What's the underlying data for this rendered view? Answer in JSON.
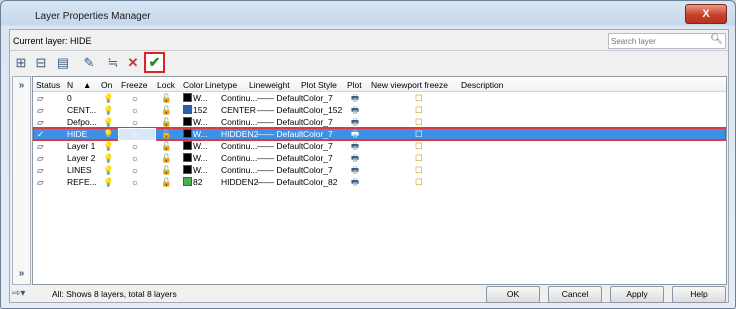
{
  "window": {
    "title": "Layer Properties Manager",
    "close_label": "X"
  },
  "current_layer": {
    "label": "Current layer: HIDE"
  },
  "search": {
    "placeholder": "Search layer",
    "icon": "search-icon"
  },
  "toolbar": {
    "icons": [
      "new-property-filter-icon",
      "new-group-filter-icon",
      "layer-states-manager-icon",
      "new-layer-icon",
      "new-layer-vp-frozen-icon",
      "delete-layer-icon",
      "set-current-icon"
    ],
    "delete_glyph": "✕",
    "set_current_glyph": "✔"
  },
  "expander": {
    "top": "»",
    "bottom": "»"
  },
  "columns": [
    "Status",
    "N",
    "▲",
    "On",
    "Freeze",
    "Lock",
    "Color",
    "Linetype",
    "Lineweight",
    "Plot Style",
    "Plot",
    "New viewport freeze",
    "Description"
  ],
  "layers": [
    {
      "name": "0",
      "color_label": "W...",
      "color_hex": "#000000",
      "linetype": "Continu...",
      "lineweight": "—— Default",
      "plot_style": "Color_7"
    },
    {
      "name": "CENT...",
      "color_label": "152",
      "color_hex": "#2f5fb0",
      "linetype": "CENTER",
      "lineweight": "—— Default",
      "plot_style": "Color_152"
    },
    {
      "name": "Defpo...",
      "color_label": "W...",
      "color_hex": "#000000",
      "linetype": "Continu...",
      "lineweight": "—— Default",
      "plot_style": "Color_7"
    },
    {
      "name": "HIDE",
      "color_label": "W...",
      "color_hex": "#000000",
      "linetype": "HIDDEN2",
      "lineweight": "—— Default",
      "plot_style": "Color_7",
      "selected": true
    },
    {
      "name": "Layer 1",
      "color_label": "W...",
      "color_hex": "#000000",
      "linetype": "Continu...",
      "lineweight": "—— Default",
      "plot_style": "Color_7"
    },
    {
      "name": "Layer 2",
      "color_label": "W...",
      "color_hex": "#000000",
      "linetype": "Continu...",
      "lineweight": "—— Default",
      "plot_style": "Color_7"
    },
    {
      "name": "LINES",
      "color_label": "W...",
      "color_hex": "#000000",
      "linetype": "Continu...",
      "lineweight": "—— Default",
      "plot_style": "Color_7"
    },
    {
      "name": "REFE...",
      "color_label": "82",
      "color_hex": "#4caf50",
      "linetype": "HIDDEN2",
      "lineweight": "—— Default",
      "plot_style": "Color_82"
    }
  ],
  "glyphs": {
    "status": "▱",
    "status_current": "✓",
    "on": "💡",
    "freeze": "☼",
    "lock": "🔓",
    "plot": "🖶",
    "nvf": "☐"
  },
  "footer": {
    "status_text": "All: Shows 8 layers, total 8 layers",
    "filter_glyph": "⇨▾",
    "ok": "OK",
    "cancel": "Cancel",
    "apply": "Apply",
    "help": "Help"
  }
}
